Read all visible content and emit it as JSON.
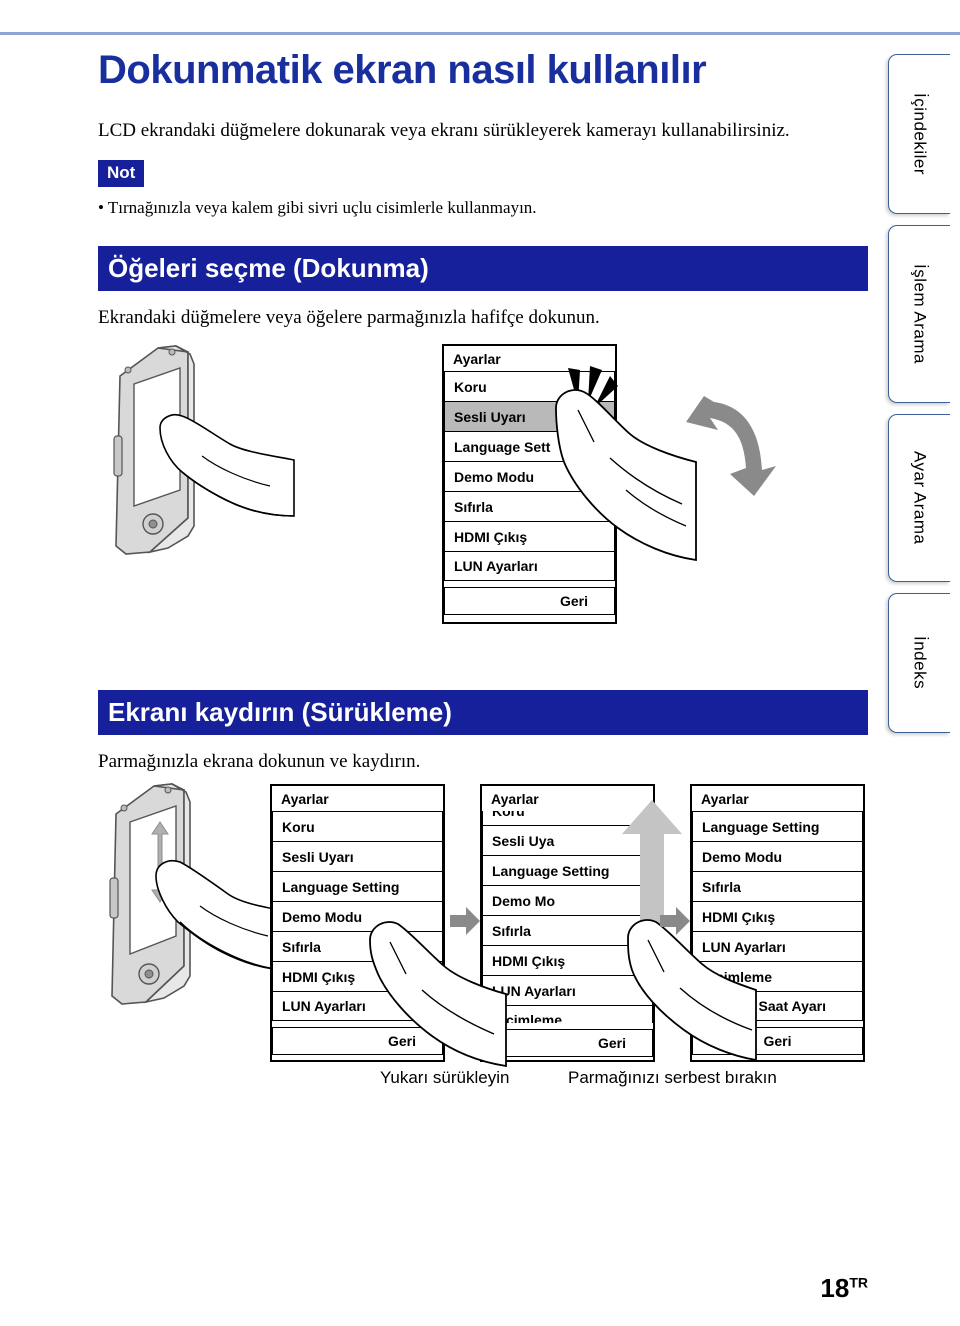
{
  "document": {
    "title": "Dokunmatik ekran nasıl kullanılır",
    "intro": "LCD ekrandaki düğmelere dokunarak veya ekranı sürükleyerek kamerayı kullanabilirsiniz.",
    "note_badge": "Not",
    "note_bullet": "• Tırnağınızla veya kalem gibi sivri uçlu cisimlerle kullanmayın.",
    "page_number": "18",
    "page_suffix": "TR"
  },
  "side_tabs": [
    {
      "label": "İçindekiler"
    },
    {
      "label": "İşlem Arama"
    },
    {
      "label": "Ayar Arama"
    },
    {
      "label": "İndeks"
    }
  ],
  "sections": [
    {
      "heading": "Öğeleri seçme (Dokunma)",
      "lead": "Ekrandaki düğmelere veya öğelere parmağınızla hafifçe dokunun."
    },
    {
      "heading": "Ekranı kaydırın (Sürükleme)",
      "lead": "Parmağınızla ekrana dokunun ve kaydırın."
    }
  ],
  "touch_screen": {
    "title": "Ayarlar",
    "rows": [
      {
        "label": "Koru",
        "highlighted": false
      },
      {
        "label": "Sesli Uyarı",
        "highlighted": true
      },
      {
        "label": "Language Sett",
        "highlighted": false
      },
      {
        "label": "Demo Modu",
        "highlighted": false
      },
      {
        "label": "Sıfırla",
        "highlighted": false
      },
      {
        "label": "HDMI Çıkış",
        "highlighted": false
      },
      {
        "label": "LUN Ayarları",
        "highlighted": false
      }
    ],
    "back": "Geri"
  },
  "drag_screens": [
    {
      "title": "Ayarlar",
      "rows": [
        "Koru",
        "Sesli Uyarı",
        "Language Setting",
        "Demo Modu",
        "Sıfırla",
        "HDMI Çıkış",
        "LUN Ayarları"
      ],
      "back": "Geri"
    },
    {
      "title": "Ayarlar",
      "rows": [
        "Koru",
        "Sesli Uya",
        "Language Setting",
        "Demo Mo",
        "Sıfırla",
        "HDMI Çıkış",
        "LUN Ayarları",
        "Biçimleme"
      ],
      "back": "Geri"
    },
    {
      "title": "Ayarlar",
      "rows": [
        "Language Setting",
        "Demo Modu",
        "Sıfırla",
        "HDMI Çıkış",
        "LUN Ayarları",
        "Biçimleme",
        "Tarih ve Saat Ayarı"
      ],
      "back": "Geri"
    }
  ],
  "captions": {
    "drag_up": "Yukarı sürükleyin",
    "release": "Parmağınızı serbest bırakın"
  },
  "colors": {
    "brand_blue": "#16209b",
    "title_blue": "#1a2f9e",
    "tab_border": "#3c6095",
    "arrow_gray": "#8a8a8a",
    "row_highlight": "#b9b9b9"
  }
}
